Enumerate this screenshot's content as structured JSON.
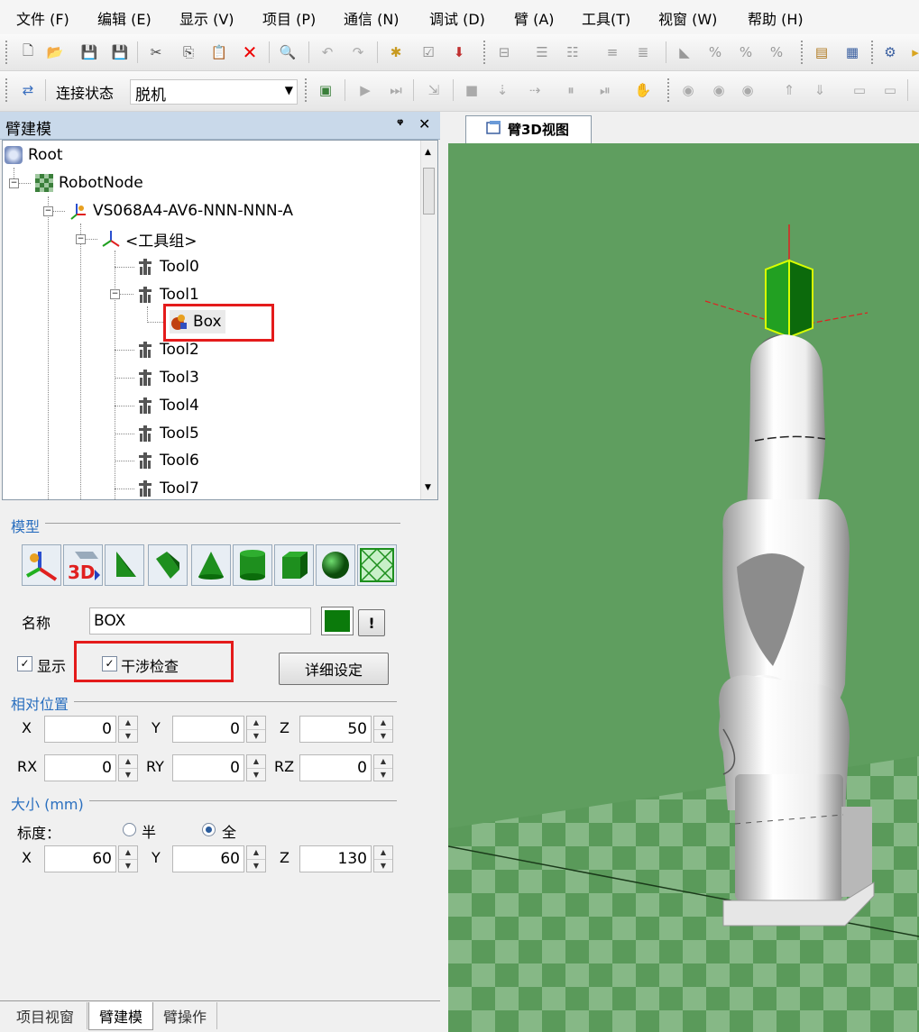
{
  "menu": [
    "文件 (F)",
    "编辑 (E)",
    "显示 (V)",
    "项目 (P)",
    "通信 (N)",
    "调试 (D)",
    "臂 (A)",
    "工具(T)",
    "视窗 (W)",
    "帮助 (H)"
  ],
  "connection": {
    "label": "连接状态",
    "value": "脱机"
  },
  "panel": {
    "title": "臂建模",
    "pin": "ᵠ",
    "close": "✕"
  },
  "tree": {
    "root": "Root",
    "robot_node": "RobotNode",
    "robot": "VS068A4-AV6-NNN-NNN-A",
    "tool_group": "<工具组>",
    "tool0": "Tool0",
    "tool1": "Tool1",
    "box": "Box",
    "tool2": "Tool2",
    "tool3": "Tool3",
    "tool4": "Tool4",
    "tool5": "Tool5",
    "tool6": "Tool6",
    "tool7": "Tool7"
  },
  "model": {
    "group_title": "模型",
    "name_label": "名称",
    "name_value": "BOX",
    "color": "#0b7a0b",
    "warn_button": "!",
    "display_label": "显示",
    "display_checked": true,
    "collision_label": "干涉检查",
    "collision_checked": true,
    "detail_button": "详细设定"
  },
  "position": {
    "group_title": "相对位置",
    "x_label": "X",
    "x": "0",
    "y_label": "Y",
    "y": "0",
    "z_label": "Z",
    "z": "50",
    "rx_label": "RX",
    "rx": "0",
    "ry_label": "RY",
    "ry": "0",
    "rz_label": "RZ",
    "rz": "0"
  },
  "size": {
    "group_title": "大小 (mm)",
    "scale_label": "标度：",
    "half_label": "半",
    "full_label": "全",
    "scale_selected": "full",
    "x_label": "X",
    "x": "60",
    "y_label": "Y",
    "y": "60",
    "z_label": "Z",
    "z": "130"
  },
  "bottom_tabs": [
    "项目视窗",
    "臂建模",
    "臂操作"
  ],
  "active_bottom_tab": "臂建模",
  "view": {
    "tab_label": "臂3D视图"
  }
}
